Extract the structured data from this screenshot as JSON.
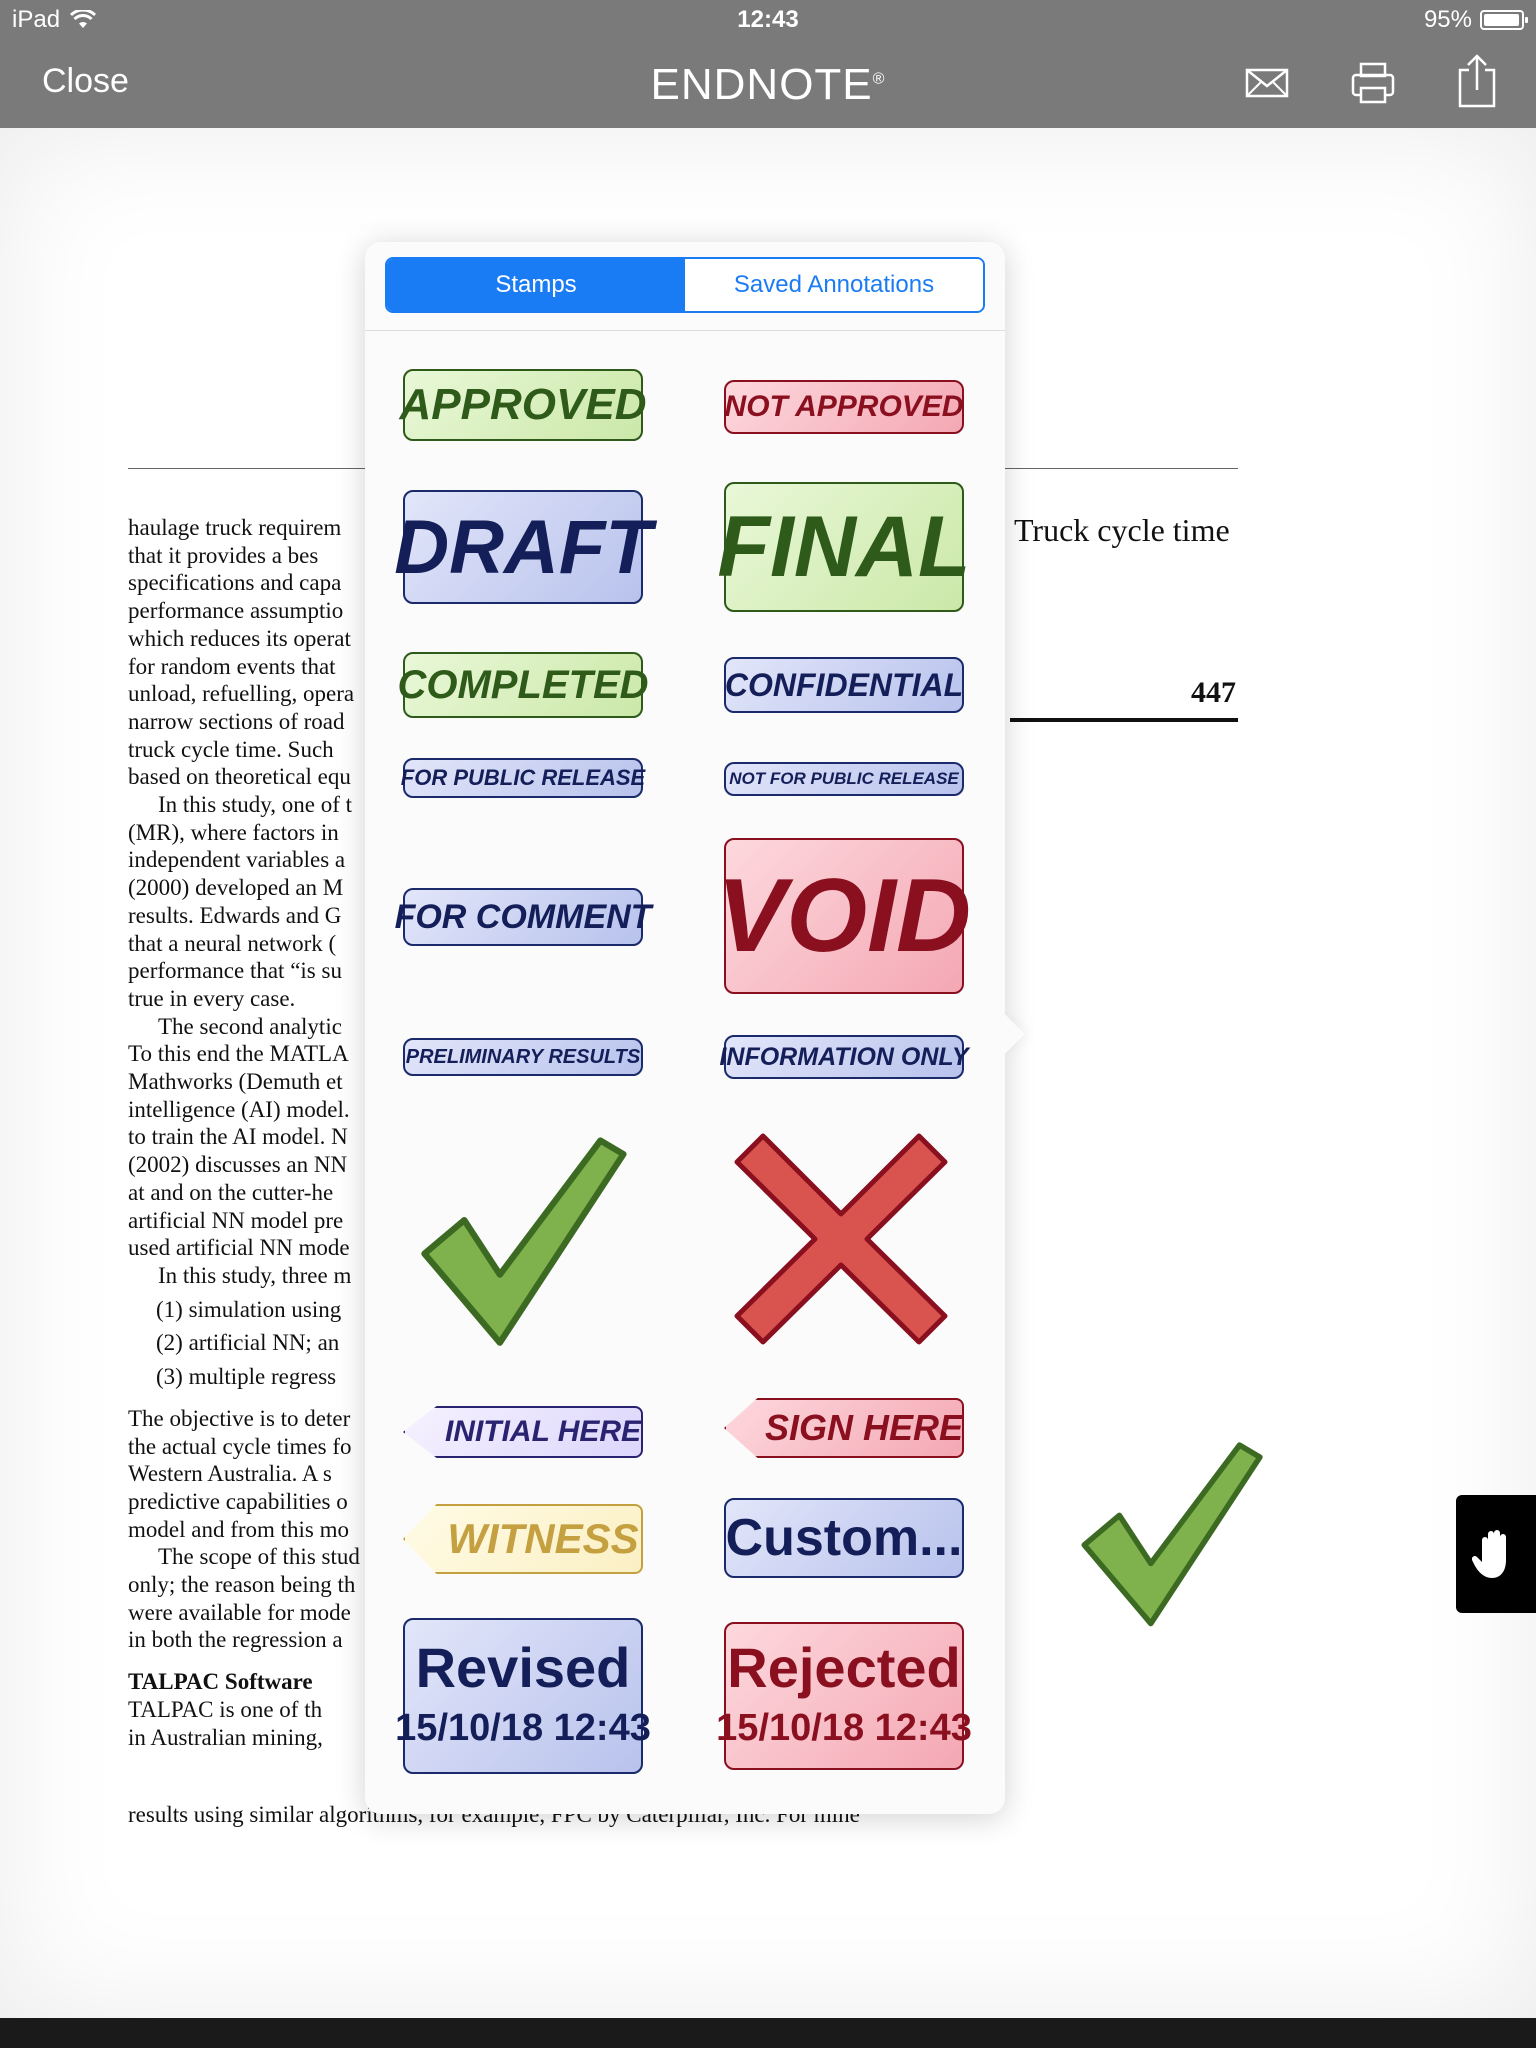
{
  "status_bar": {
    "device": "iPad",
    "time": "12:43",
    "battery": "95%",
    "battery_level": 0.95
  },
  "nav": {
    "close_label": "Close",
    "title": "ENDNOTE",
    "title_mark": "®"
  },
  "document": {
    "left_lines": [
      "haulage truck requirem",
      "that it provides a bes",
      "specifications and capa",
      "performance assumptio",
      "which reduces its operat",
      "for random events that",
      "unload, refuelling, opera",
      "narrow sections of road",
      "truck cycle time. Such",
      "based on theoretical equ",
      "In this study, one of t",
      "(MR), where factors in",
      "independent variables a",
      "(2000) developed an M",
      "results. Edwards and G",
      "that a neural network (",
      "performance that “is su",
      "true in every case.",
      "The second analytic",
      "To this end the MATLA",
      "Mathworks (Demuth et",
      "intelligence (AI) model.",
      "to train the AI model. N",
      "(2002) discusses an NN",
      "at and on the cutter-he",
      "artificial NN model pre",
      "used artificial NN mode",
      "In this study, three m"
    ],
    "list_items": [
      "(1)  simulation using",
      "(2)  artificial NN; an",
      "(3)  multiple regress"
    ],
    "left_lines_2": [
      "The objective is to deter",
      "the actual cycle times fo",
      "Western Australia. A s",
      "predictive capabilities o",
      "model and from this mo",
      "The scope of this stud",
      "only; the reason being th",
      "were available for mode",
      "in both the regression a"
    ],
    "section_heading": "TALPAC Software",
    "left_lines_3": [
      "TALPAC is one of th",
      "in Australian mining,"
    ],
    "bottom_line": "results using similar algorithms, for example, FPC by Caterpillar, Inc. For mine",
    "right_title": "Truck cycle time",
    "right_number": "447"
  },
  "popover": {
    "tabs": [
      {
        "label": "Stamps"
      },
      {
        "label": "Saved Annotations"
      }
    ],
    "stamps": {
      "approved": "APPROVED",
      "not_approved": "NOT APPROVED",
      "draft": "DRAFT",
      "final": "FINAL",
      "completed": "COMPLETED",
      "confidential": "CONFIDENTIAL",
      "for_public_release": "FOR PUBLIC RELEASE",
      "not_for_public_release": "NOT FOR PUBLIC RELEASE",
      "for_comment": "FOR COMMENT",
      "void": "VOID",
      "preliminary_results": "PRELIMINARY RESULTS",
      "information_only": "INFORMATION ONLY",
      "initial_here": "INITIAL HERE",
      "sign_here": "SIGN HERE",
      "witness": "WITNESS",
      "custom": "Custom...",
      "revised": "Revised",
      "revised_date": "15/10/18 12:43",
      "rejected": "Rejected",
      "rejected_date": "15/10/18 12:43"
    }
  },
  "colors": {
    "chrome": "#7a7a7a",
    "accent": "#1a7cf5",
    "stamp_green": "#2e5a1a",
    "stamp_red": "#8a1020",
    "stamp_blue": "#141e58",
    "stamp_yellow": "#c4a040"
  }
}
